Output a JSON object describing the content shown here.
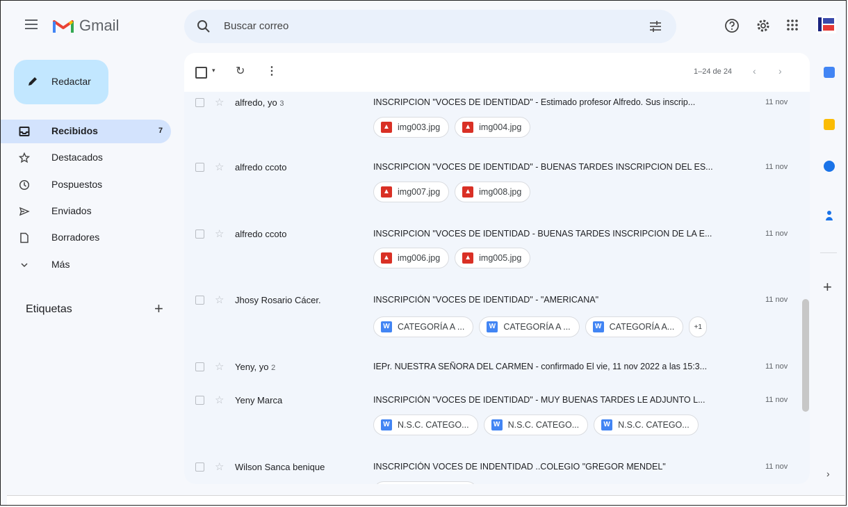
{
  "app": {
    "name": "Gmail"
  },
  "search": {
    "placeholder": "Buscar correo"
  },
  "sidebar": {
    "compose_label": "Redactar",
    "items": [
      {
        "label": "Recibidos",
        "count": "7",
        "icon": "inbox-icon",
        "active": true
      },
      {
        "label": "Destacados",
        "icon": "star-icon"
      },
      {
        "label": "Pospuestos",
        "icon": "clock-icon"
      },
      {
        "label": "Enviados",
        "icon": "send-icon"
      },
      {
        "label": "Borradores",
        "icon": "draft-icon"
      },
      {
        "label": "Más",
        "icon": "chevron-down-icon"
      }
    ],
    "labels_title": "Etiquetas"
  },
  "toolbar": {
    "pager": "1–24 de 24"
  },
  "emails": [
    {
      "sender": "alfredo, yo",
      "count": "3",
      "subject": "INSCRIPCION \"VOCES DE IDENTIDAD\" - Estimado profesor Alfredo. Sus inscrip...",
      "date": "11 nov",
      "attachments": [
        {
          "name": "img003.jpg",
          "type": "image"
        },
        {
          "name": "img004.jpg",
          "type": "image"
        }
      ]
    },
    {
      "sender": "alfredo ccoto",
      "subject": "INSCRIPCION \"VOCES DE IDENTIDAD\" - BUENAS TARDES INSCRIPCION DEL ES...",
      "date": "11 nov",
      "attachments": [
        {
          "name": "img007.jpg",
          "type": "image"
        },
        {
          "name": "img008.jpg",
          "type": "image"
        }
      ]
    },
    {
      "sender": "alfredo ccoto",
      "subject": "INSCRIPCION \"VOCES DE IDENTIDAD - BUENAS TARDES INSCRIPCION DE LA E...",
      "date": "11 nov",
      "attachments": [
        {
          "name": "img006.jpg",
          "type": "image"
        },
        {
          "name": "img005.jpg",
          "type": "image"
        }
      ]
    },
    {
      "sender": "Jhosy Rosario Cácer.",
      "subject": "INSCRIPCIÓN \"VOCES DE IDENTIDAD\" - \"AMERICANA\"",
      "date": "11 nov",
      "attachments": [
        {
          "name": "CATEGORÍA A ...",
          "type": "doc"
        },
        {
          "name": "CATEGORÍA A ...",
          "type": "doc"
        },
        {
          "name": "CATEGORÍA A...",
          "type": "doc"
        }
      ],
      "more": "+1"
    },
    {
      "sender": "Yeny, yo",
      "count": "2",
      "subject": "IEPr. NUESTRA SEÑORA DEL CARMEN - confirmado El vie, 11 nov 2022 a las 15:3...",
      "date": "11 nov"
    },
    {
      "sender": "Yeny Marca",
      "subject": "INSCRIPCIÓN \"VOCES DE IDENTIDAD\" - MUY BUENAS TARDES LE ADJUNTO L...",
      "date": "11 nov",
      "attachments": [
        {
          "name": "N.S.C. CATEGO...",
          "type": "doc"
        },
        {
          "name": "N.S.C. CATEGO...",
          "type": "doc"
        },
        {
          "name": "N.S.C. CATEGO...",
          "type": "doc"
        }
      ]
    },
    {
      "sender": "Wilson Sanca benique",
      "subject": "INSCRIPCIÓN VOCES DE INDENTIDAD ..COLEGIO \"GREGOR MENDEL\"",
      "date": "11 nov"
    }
  ],
  "colors": {
    "accent": "#c2e7ff",
    "active_nav": "#d3e3fd",
    "background": "#f6f8fc"
  }
}
